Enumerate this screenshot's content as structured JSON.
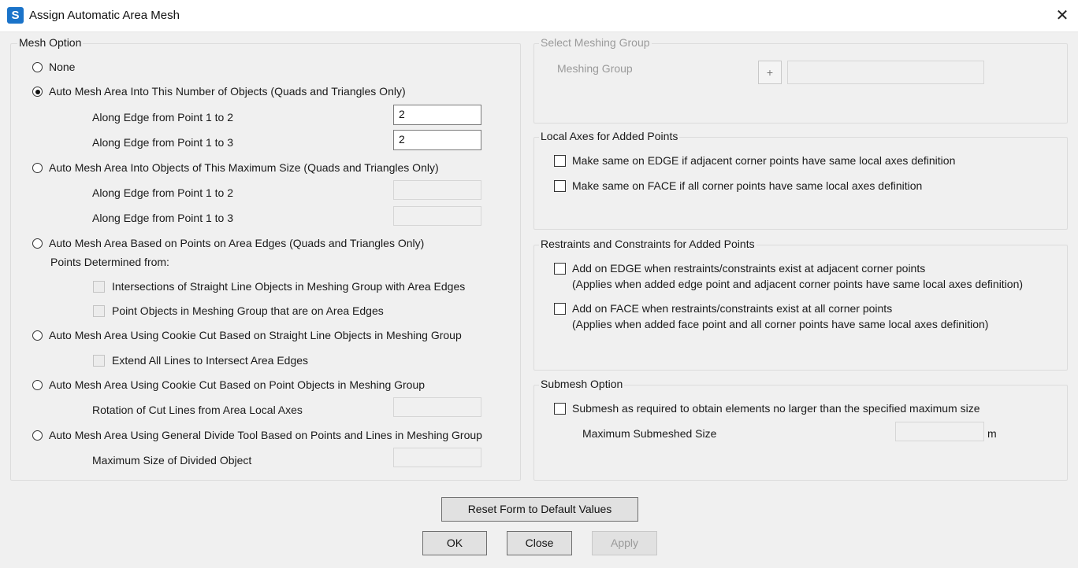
{
  "window": {
    "title": "Assign Automatic Area Mesh",
    "icon_letter": "S",
    "close_glyph": "✕"
  },
  "mesh_option": {
    "legend": "Mesh Option",
    "selected": "auto_number",
    "none_label": "None",
    "auto_number": {
      "label": "Auto Mesh Area Into This Number of Objects  (Quads and Triangles Only)",
      "edge12_label": "Along Edge from Point 1 to 2",
      "edge12_value": "2",
      "edge13_label": "Along Edge from Point 1 to 3",
      "edge13_value": "2"
    },
    "auto_size": {
      "label": "Auto Mesh Area Into Objects of This Maximum Size  (Quads and Triangles Only)",
      "edge12_label": "Along Edge from Point 1 to 2",
      "edge12_value": "",
      "edge13_label": "Along Edge from Point 1 to 3",
      "edge13_value": ""
    },
    "auto_points": {
      "label": "Auto Mesh Area Based on Points on Area Edges  (Quads and Triangles Only)",
      "sublabel": "Points Determined from:",
      "opt1_label": "Intersections of Straight Line Objects in Meshing Group with Area Edges",
      "opt2_label": "Point Objects in Meshing Group that are on Area Edges"
    },
    "cookie_lines": {
      "label": "Auto Mesh Area Using Cookie Cut Based on Straight Line Objects in Meshing Group",
      "extend_label": "Extend All Lines to Intersect Area Edges"
    },
    "cookie_points": {
      "label": "Auto Mesh Area Using Cookie Cut Based on Point Objects in Meshing Group",
      "rotation_label": "Rotation of Cut Lines from Area Local Axes",
      "rotation_value": ""
    },
    "general_divide": {
      "label": "Auto Mesh Area Using General Divide Tool Based on Points and Lines in Meshing Group",
      "maxsize_label": "Maximum Size of Divided Object",
      "maxsize_value": ""
    }
  },
  "meshing_group": {
    "legend": "Select Meshing Group",
    "label": "Meshing Group",
    "add_glyph": "+",
    "value": ""
  },
  "local_axes": {
    "legend": "Local Axes for Added Points",
    "edge_label": "Make same on EDGE if adjacent corner points have same local axes definition",
    "edge_checked": false,
    "face_label": "Make same on FACE if all corner points have same local axes definition",
    "face_checked": false
  },
  "restraints": {
    "legend": "Restraints and Constraints for Added Points",
    "edge_label": "Add on EDGE when restraints/constraints exist at adjacent corner points",
    "edge_note": "(Applies when added edge point and adjacent corner points have same local axes definition)",
    "face_label": "Add on FACE when restraints/constraints exist at all corner points",
    "face_note": "(Applies when added face point and all corner points have same local axes definition)"
  },
  "submesh": {
    "legend": "Submesh Option",
    "check_label": "Submesh as required to obtain elements no larger than the specified maximum size",
    "max_label": "Maximum Submeshed Size",
    "max_value": "",
    "unit": "m"
  },
  "buttons": {
    "reset": "Reset Form to Default Values",
    "ok": "OK",
    "close": "Close",
    "apply": "Apply"
  }
}
